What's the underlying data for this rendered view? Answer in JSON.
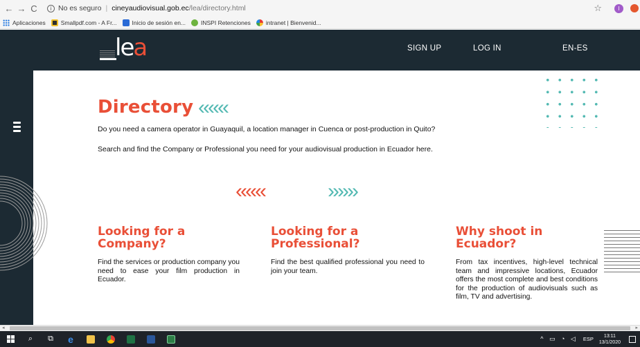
{
  "browser": {
    "security_label": "No es seguro",
    "url_host": "cineyaudiovisual.gob.ec",
    "url_path": "/lea/directory.html",
    "nav": {
      "back": "←",
      "forward": "→",
      "reload": "C"
    },
    "star": "☆",
    "profile_initial": "I",
    "bookmarks": [
      {
        "label": "Aplicaciones",
        "icon": "apps-icon"
      },
      {
        "label": "Smallpdf.com - A Fr...",
        "icon": "smallpdf-icon"
      },
      {
        "label": "Inicio de sesión en...",
        "icon": "zoho-icon"
      },
      {
        "label": "INSPI Retenciones",
        "icon": "inspi-icon"
      },
      {
        "label": "intranet | Bienvenid...",
        "icon": "intranet-icon"
      }
    ]
  },
  "site": {
    "logo_prefix": "l",
    "logo_e": "e",
    "logo_a": "a",
    "nav": {
      "signup": "SIGN UP",
      "login": "LOG IN",
      "lang": "EN-ES"
    },
    "title": "Directory",
    "title_chevrons": "‹‹‹‹‹‹",
    "intro_line1": "Do you need a camera operator in Guayaquil, a location manager in Cuenca or post-production in Quito?",
    "intro_line2": "Search and find the Company or Professional you need for your audiovisual production in Ecuador here.",
    "chevrons_left": "‹‹‹‹‹‹",
    "chevrons_right": "››››››",
    "columns": [
      {
        "title": "Looking for a Company?",
        "text": "Find the services or production company you need to ease your film production in Ecuador."
      },
      {
        "title": "Looking for a Professional?",
        "text": "Find the best qualified professional you need to join your team."
      },
      {
        "title": "Why shoot in Ecuador?",
        "text": "From tax incentives, high-level technical team and impressive locations, Ecuador offers the most complete and best conditions for the production of audiovisuals such as film, TV and advertising."
      }
    ],
    "colors": {
      "accent_red": "#e94f37",
      "accent_teal": "#53b9b2",
      "dark": "#1c2a33"
    }
  },
  "taskbar": {
    "lang": "ESP",
    "time": "13:11",
    "date": "13/1/2020",
    "apps": [
      "windows-icon",
      "search-icon",
      "task-view-icon",
      "edge-icon",
      "file-explorer-icon",
      "chrome-icon",
      "excel-icon",
      "word-icon",
      "app-icon"
    ]
  }
}
